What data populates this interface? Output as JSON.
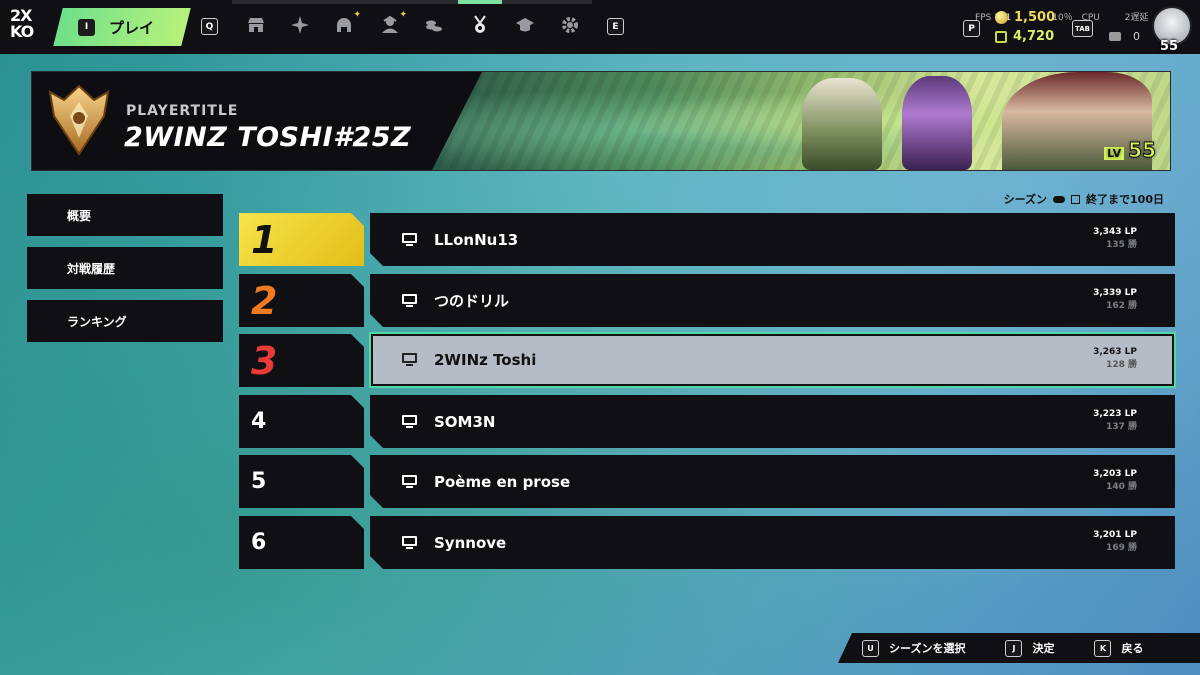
{
  "topbar": {
    "logo_top": "2X",
    "logo_bottom": "KO",
    "play_key": "I",
    "play_label": "プレイ",
    "nav_key_left": "Q",
    "nav_key_right": "E",
    "nav_icons": [
      "store-icon",
      "compass-icon",
      "helmet-icon",
      "character-icon",
      "currency-icon",
      "medal-icon",
      "academy-icon",
      "gear-icon"
    ],
    "hud_fps": "FPS",
    "hud_fps_value": "101",
    "hud_pct": "10％",
    "hud_cpu": "CPU",
    "hud_delay": "2遅延",
    "currency_gold": "1,500",
    "currency_gems": "4,720",
    "key_p": "P",
    "key_tab": "TAB",
    "chat_count": "0",
    "avatar_level": "55"
  },
  "banner": {
    "player_title": "PLAYERTITLE",
    "player_name": "2WINZ TOSHI#25Z",
    "level_label": "LV",
    "level_value": "55"
  },
  "sidebar": {
    "items": [
      {
        "label": "概要"
      },
      {
        "label": "対戦履歴"
      },
      {
        "label": "ランキング"
      }
    ]
  },
  "season": {
    "label": "シーズン",
    "remaining": "終了まで100日"
  },
  "ranking": {
    "rows": [
      {
        "rank": "1",
        "name": "LLonNu13",
        "lp": "3,343 LP",
        "wins": "135 勝"
      },
      {
        "rank": "2",
        "name": "つのドリル",
        "lp": "3,339 LP",
        "wins": "162 勝"
      },
      {
        "rank": "3",
        "name": "2WINz Toshi",
        "lp": "3,263 LP",
        "wins": "128 勝"
      },
      {
        "rank": "4",
        "name": "SOM3N",
        "lp": "3,223 LP",
        "wins": "137 勝"
      },
      {
        "rank": "5",
        "name": "Poème en prose",
        "lp": "3,203 LP",
        "wins": "140 勝"
      },
      {
        "rank": "6",
        "name": "Synnove",
        "lp": "3,201 LP",
        "wins": "169 勝"
      }
    ],
    "highlight_color": "#4fd8a8",
    "gold_color": "#f7e44a",
    "silver_color": "#f07a22",
    "bronze_color": "#e83a36"
  },
  "controls": {
    "items": [
      {
        "key": "U",
        "label": "シーズンを選択"
      },
      {
        "key": "J",
        "label": "決定"
      },
      {
        "key": "K",
        "label": "戻る"
      }
    ]
  }
}
